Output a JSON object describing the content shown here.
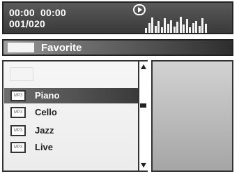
{
  "status": {
    "time_elapsed": "00:00",
    "time_total": "00:00",
    "track_counter": "001/020",
    "play_icon": "play-circle-icon"
  },
  "equalizer": {
    "levels": [
      0.25,
      0.55,
      0.85,
      0.4,
      0.65,
      0.3,
      0.8,
      0.5,
      0.7,
      0.35,
      0.6,
      0.9,
      0.45,
      0.75,
      0.3,
      0.55,
      0.65,
      0.4,
      0.8,
      0.5
    ]
  },
  "header": {
    "title": "Favorite"
  },
  "list": {
    "selected_index": 0,
    "items": [
      {
        "label": "Piano",
        "icon": "audio-file-icon",
        "icon_text": "MP3"
      },
      {
        "label": "Cello",
        "icon": "audio-file-icon",
        "icon_text": "MP3"
      },
      {
        "label": "Jazz",
        "icon": "audio-file-icon",
        "icon_text": "MP3"
      },
      {
        "label": "Live",
        "icon": "audio-file-icon",
        "icon_text": "MP3"
      }
    ]
  },
  "colors": {
    "status_bg": "#4a4a4a",
    "header_fg": "#ffffff",
    "selected_row_bg": "#4a4a4a",
    "preview_bg": "#bdbdbd"
  }
}
